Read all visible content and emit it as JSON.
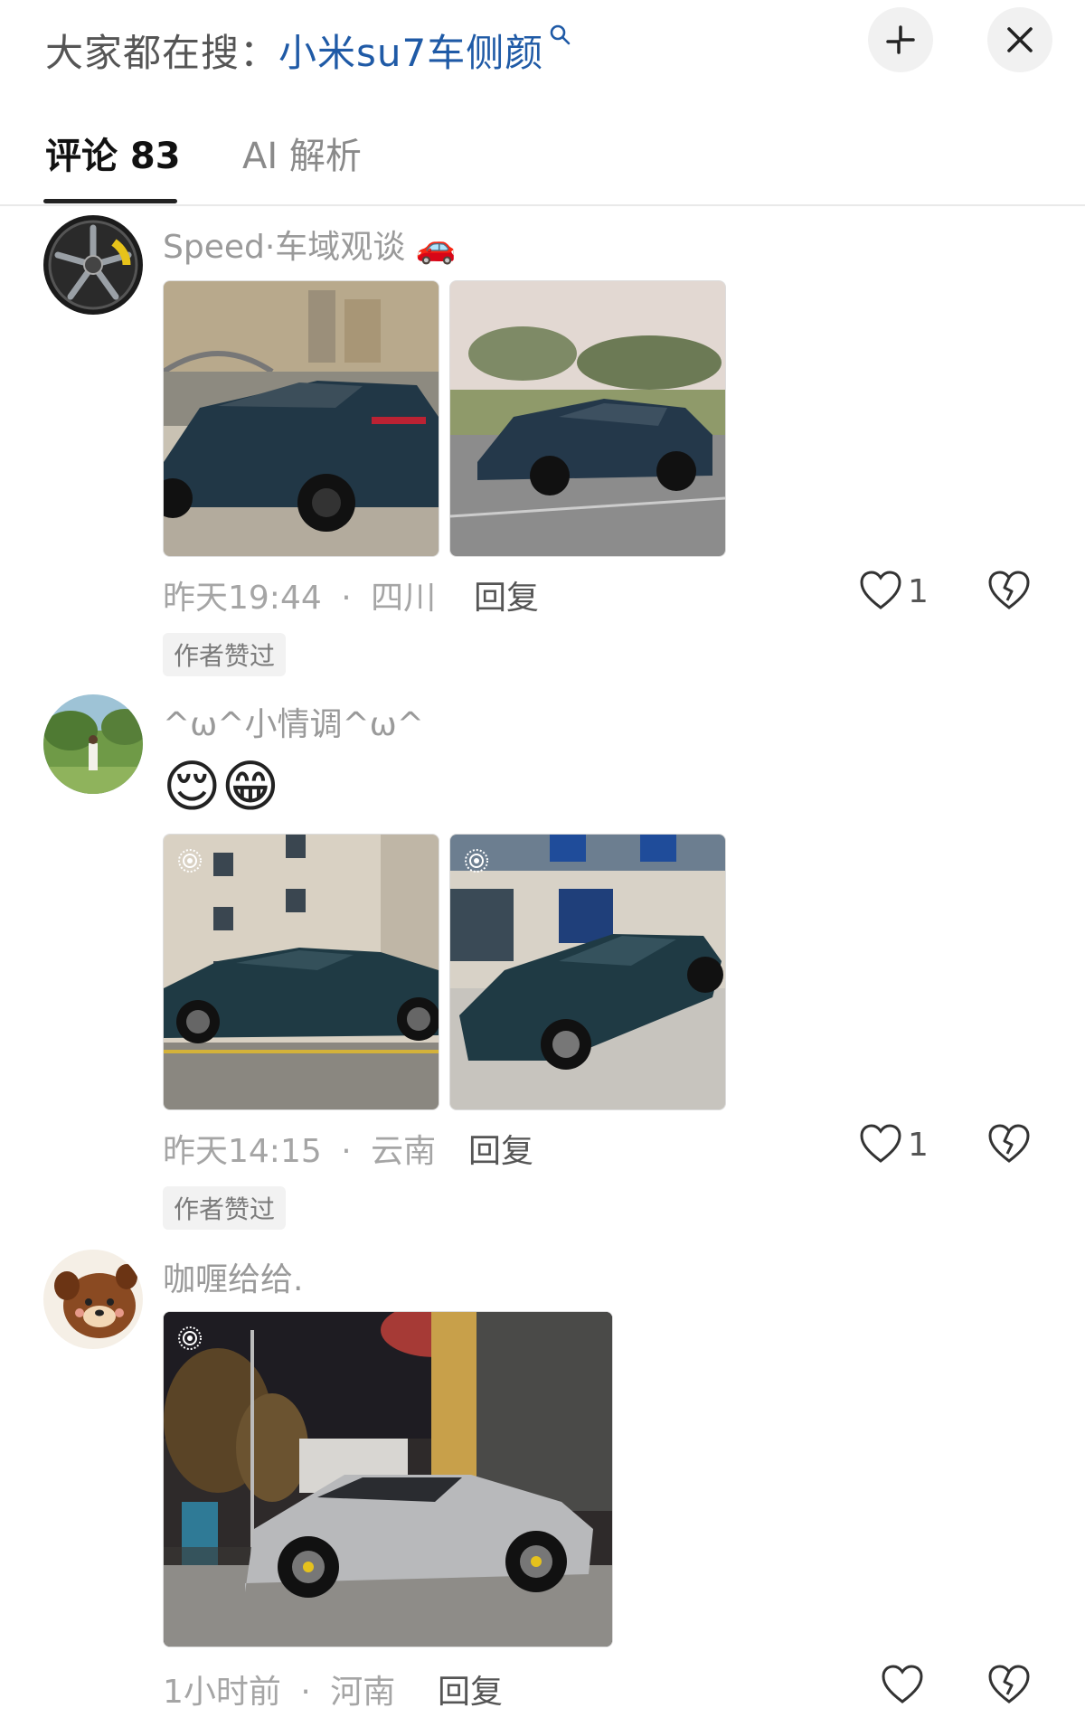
{
  "search": {
    "prefix": "大家都在搜：",
    "term": "小米su7车侧颜",
    "icon": "search-icon"
  },
  "header_buttons": {
    "shrink_icon": "shrink-icon",
    "close_icon": "close-icon"
  },
  "tabs": [
    {
      "label": "评论 83",
      "active": true
    },
    {
      "label": "AI 解析",
      "active": false
    }
  ],
  "comments": [
    {
      "username": "Speed·车域观谈 🚗",
      "time": "昨天19:44",
      "separator": "·",
      "location": "四川",
      "reply_label": "回复",
      "likes": "1",
      "badge": "作者赞过",
      "images": 2
    },
    {
      "username": "^ω^小情调^ω^",
      "emoji_text": "😌😁",
      "time": "昨天14:15",
      "separator": "·",
      "location": "云南",
      "reply_label": "回复",
      "likes": "1",
      "badge": "作者赞过",
      "images": 2
    },
    {
      "username": "咖喱给给.",
      "time": "1小时前",
      "separator": "·",
      "location": "河南",
      "reply_label": "回复",
      "likes": "",
      "images": 1
    }
  ],
  "colors": {
    "search_term": "#1f5aa6",
    "tab_active": "#111111",
    "tab_inactive": "#8a8a8a",
    "meta_text": "#a5a5a5"
  }
}
